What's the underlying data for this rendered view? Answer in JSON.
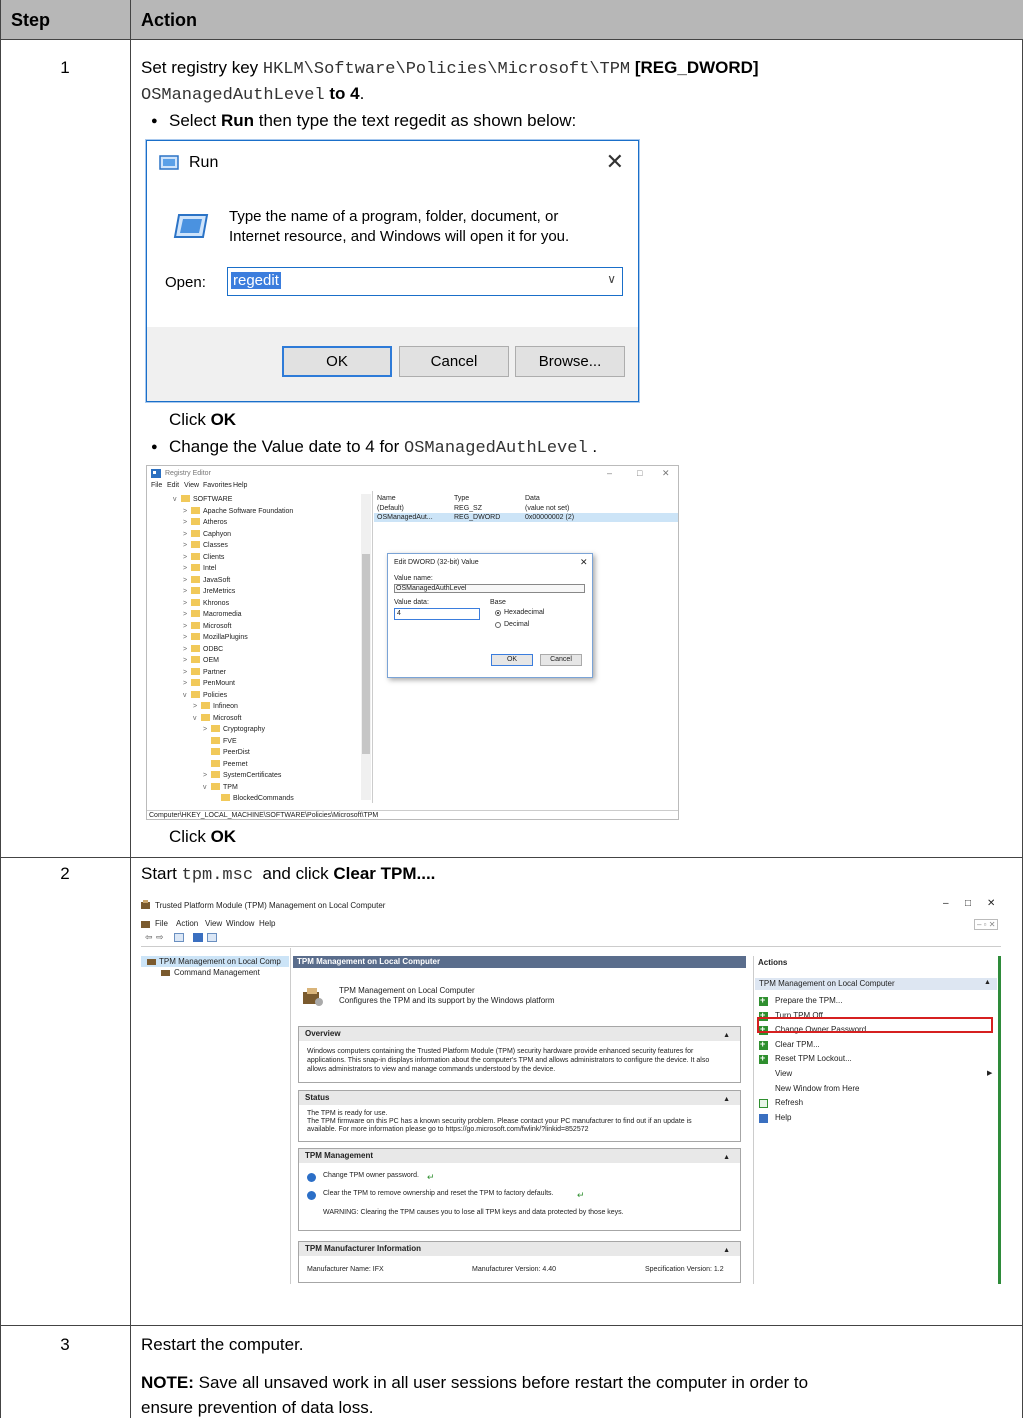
{
  "table": {
    "header_step": "Step",
    "header_action": "Action"
  },
  "step1": {
    "number": "1",
    "line1_pre": "Set registry key ",
    "line1_key": "HKLM\\Software\\Policies\\Microsoft\\TPM",
    "line1_type": " [REG_DWORD]",
    "line2_value": "OSManagedAuthLevel",
    "line2_to": " to ",
    "line2_num": "4",
    "line2_end": ".",
    "bullet1_pre": "Select ",
    "bullet1_bold": "Run",
    "bullet1_post": " then type the text regedit as shown below:",
    "click1_pre": "Click ",
    "click1_bold": "OK",
    "bullet2_pre": "Change the Value date to 4 for ",
    "bullet2_mono": "OSManagedAuthLevel",
    "bullet2_post": " .",
    "click2_pre": "Click ",
    "click2_bold": "OK"
  },
  "run_dialog": {
    "title": "Run",
    "message": "Type the name of a program, folder, document, or Internet resource, and Windows will open it for you.",
    "open_label": "Open:",
    "value": "regedit",
    "ok": "OK",
    "cancel": "Cancel",
    "browse": "Browse..."
  },
  "registry": {
    "title": "Registry Editor",
    "menu": [
      "File",
      "Edit",
      "View",
      "Favorites",
      "Help"
    ],
    "tree": [
      "SOFTWARE",
      "Apache Software Foundation",
      "Atheros",
      "Caphyon",
      "Classes",
      "Clients",
      "Intel",
      "JavaSoft",
      "JreMetrics",
      "Khronos",
      "Macromedia",
      "Microsoft",
      "MozillaPlugins",
      "ODBC",
      "OEM",
      "Partner",
      "PenMount",
      "Policies",
      "Infineon",
      "Microsoft",
      "Cryptography",
      "FVE",
      "PeerDist",
      "Peernet",
      "SystemCertificates",
      "TPM",
      "BlockedCommands"
    ],
    "columns": [
      "Name",
      "Type",
      "Data"
    ],
    "rows": [
      [
        "(Default)",
        "REG_SZ",
        "(value not set)"
      ],
      [
        "OSManagedAut...",
        "REG_DWORD",
        "0x00000002 (2)"
      ]
    ],
    "status": "Computer\\HKEY_LOCAL_MACHINE\\SOFTWARE\\Policies\\Microsoft\\TPM",
    "dialog": {
      "title": "Edit DWORD (32-bit) Value",
      "value_name_label": "Value name:",
      "value_name": "OSManagedAuthLevel",
      "value_data_label": "Value data:",
      "value_data": "4",
      "base_label": "Base",
      "hex": "Hexadecimal",
      "dec": "Decimal",
      "ok": "OK",
      "cancel": "Cancel"
    }
  },
  "step2": {
    "number": "2",
    "pre": "Start ",
    "cmd": "tpm.msc",
    "mid": "  and click ",
    "bold": "Clear TPM...."
  },
  "tpm_window": {
    "title": "Trusted Platform Module (TPM) Management on Local Computer",
    "menu": [
      "File",
      "Action",
      "View",
      "Window",
      "Help"
    ],
    "tree_root": "TPM Management on Local Comp",
    "tree_child": "Command Management",
    "center_header": "TPM Management on Local Computer",
    "intro_title": "TPM Management on Local Computer",
    "intro_sub": "Configures the TPM and its support by the Windows platform",
    "overview_title": "Overview",
    "overview_text1": "Windows computers containing the Trusted Platform Module (TPM) security hardware provide enhanced security features for",
    "overview_text2": "applications. This snap-in displays information about the computer's TPM and allows administrators to configure the device. It also",
    "overview_text3": "allows administrators to view and manage commands understood by the device.",
    "status_title": "Status",
    "status_text1": "The TPM is ready for use.",
    "status_text2": "The TPM firmware on this PC has a known security problem. Please contact your PC manufacturer to find out if an update is",
    "status_text3": "available. For more information please go to https://go.microsoft.com/fwlink/?linkid=852572",
    "mgmt_title": "TPM Management",
    "mgmt_item1": "Change TPM owner password.",
    "mgmt_item2": "Clear the TPM to remove ownership and reset the TPM to factory defaults.",
    "mgmt_warning": "WARNING: Clearing the TPM causes you to lose all TPM keys and data protected by those keys.",
    "mfr_title": "TPM Manufacturer Information",
    "mfr_name": "Manufacturer Name:  IFX",
    "mfr_version": "Manufacturer Version:  4.40",
    "spec_version": "Specification Version:  1.2",
    "actions_header": "Actions",
    "actions_sub": "TPM Management on Local Computer",
    "actions": [
      "Prepare the TPM...",
      "Turn TPM Off...",
      "Change Owner Password...",
      "Clear TPM...",
      "Reset TPM Lockout...",
      "View",
      "New Window from Here",
      "Refresh",
      "Help"
    ]
  },
  "step3": {
    "number": "3",
    "text": "Restart the computer.",
    "note_label": "NOTE:",
    "note_line1": " Save all unsaved work in all user sessions before restart the computer in order to",
    "note_line2": "ensure prevention of data loss."
  }
}
